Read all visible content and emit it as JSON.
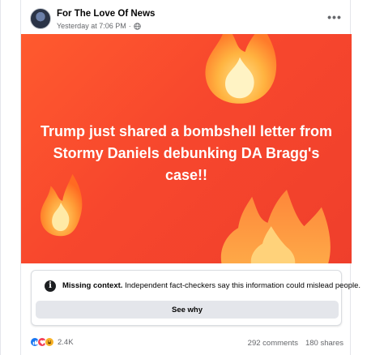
{
  "post": {
    "page_name": "For The Love Of News",
    "timestamp": "Yesterday at 7:06 PM",
    "separator": "·",
    "audience_icon": "globe-icon",
    "more_icon": "more-options-icon",
    "more_label": "•••"
  },
  "image": {
    "headline": "Trump just shared a bombshell letter from Stormy Daniels debunking DA Bragg's case!!",
    "background_colors": [
      "#ff5a2e",
      "#ef3f2c"
    ],
    "decoration_icons": [
      "fire-icon",
      "fire-icon",
      "fire-icon"
    ]
  },
  "fact_check": {
    "icon": "info-icon",
    "icon_glyph": "i",
    "title": "Missing context.",
    "message": "Independent fact-checkers say this information could mislead people.",
    "button_label": "See why"
  },
  "engagement": {
    "reaction_icons": [
      "like-icon",
      "love-icon",
      "haha-icon"
    ],
    "reaction_count": "2.4K",
    "comments": "292 comments",
    "shares": "180 shares"
  }
}
